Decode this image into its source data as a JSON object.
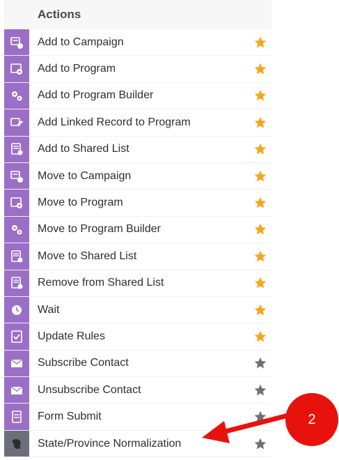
{
  "panel": {
    "header": "Actions"
  },
  "actions": [
    {
      "label": "Add to Campaign",
      "icon": "campaign-icon",
      "icon_color": "#9b6fc6",
      "starred": true
    },
    {
      "label": "Add to Program",
      "icon": "program-icon",
      "icon_color": "#9b6fc6",
      "starred": true
    },
    {
      "label": "Add to Program Builder",
      "icon": "program-builder-icon",
      "icon_color": "#9b6fc6",
      "starred": true
    },
    {
      "label": "Add Linked Record to Program",
      "icon": "linked-record-icon",
      "icon_color": "#9b6fc6",
      "starred": true
    },
    {
      "label": "Add to Shared List",
      "icon": "shared-list-icon",
      "icon_color": "#9b6fc6",
      "starred": true
    },
    {
      "label": "Move to Campaign",
      "icon": "campaign-icon",
      "icon_color": "#9b6fc6",
      "starred": true
    },
    {
      "label": "Move to Program",
      "icon": "program-icon",
      "icon_color": "#9b6fc6",
      "starred": true
    },
    {
      "label": "Move to Program Builder",
      "icon": "program-builder-icon",
      "icon_color": "#9b6fc6",
      "starred": true
    },
    {
      "label": "Move to Shared List",
      "icon": "shared-list-icon",
      "icon_color": "#9b6fc6",
      "starred": true
    },
    {
      "label": "Remove from Shared List",
      "icon": "shared-list-icon",
      "icon_color": "#9b6fc6",
      "starred": true
    },
    {
      "label": "Wait",
      "icon": "clock-icon",
      "icon_color": "#9b6fc6",
      "starred": true
    },
    {
      "label": "Update Rules",
      "icon": "checklist-icon",
      "icon_color": "#9b6fc6",
      "starred": true
    },
    {
      "label": "Subscribe Contact",
      "icon": "envelope-icon",
      "icon_color": "#9b6fc6",
      "starred": false
    },
    {
      "label": "Unsubscribe Contact",
      "icon": "envelope-icon",
      "icon_color": "#9b6fc6",
      "starred": false
    },
    {
      "label": "Form Submit",
      "icon": "form-icon",
      "icon_color": "#9b6fc6",
      "starred": false
    },
    {
      "label": "State/Province Normalization",
      "icon": "map-icon",
      "icon_color": "#6c6f7a",
      "starred": false
    }
  ],
  "colors": {
    "star_on": "#f5a81c",
    "star_off": "#6b7079",
    "callout": "#e8120c"
  },
  "annotation": {
    "callout_number": "2"
  }
}
